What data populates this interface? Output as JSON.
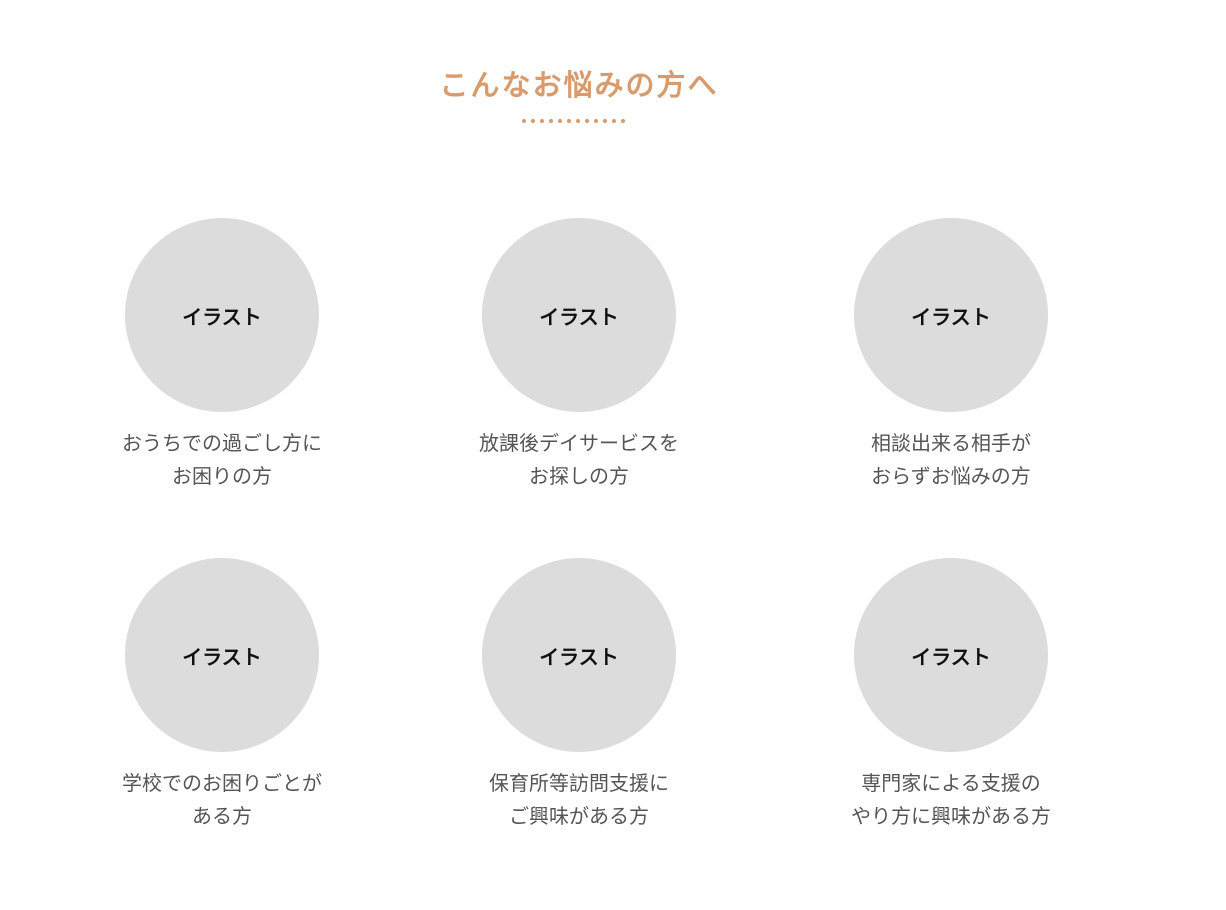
{
  "section": {
    "title": "こんなお悩みの方へ",
    "accent_color": "#D99A6C",
    "dot_count": 12
  },
  "cards": [
    {
      "illustration_label": "イラスト",
      "caption_line1": "おうちでの過ごし方に",
      "caption_line2": "お困りの方"
    },
    {
      "illustration_label": "イラスト",
      "caption_line1": "放課後デイサービスを",
      "caption_line2": "お探しの方"
    },
    {
      "illustration_label": "イラスト",
      "caption_line1": "相談出来る相手が",
      "caption_line2": "おらずお悩みの方"
    },
    {
      "illustration_label": "イラスト",
      "caption_line1": "学校でのお困りごとが",
      "caption_line2": "ある方"
    },
    {
      "illustration_label": "イラスト",
      "caption_line1": "保育所等訪問支援に",
      "caption_line2": "ご興味がある方"
    },
    {
      "illustration_label": "イラスト",
      "caption_line1": "専門家による支援の",
      "caption_line2": "やり方に興味がある方"
    }
  ],
  "colors": {
    "circle_fill": "#DCDCDC",
    "caption_text": "#555555"
  }
}
